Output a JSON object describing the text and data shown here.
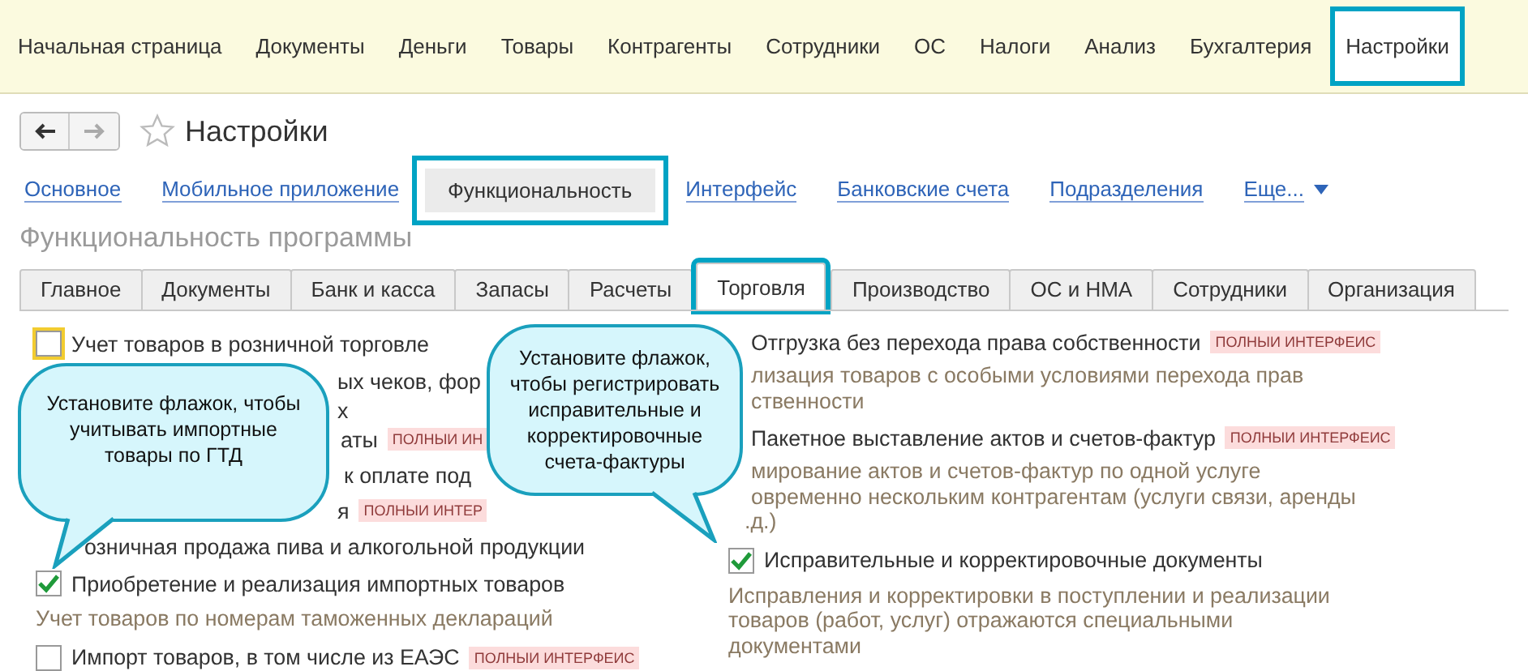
{
  "top_nav": [
    {
      "label": "Начальная страница",
      "selected": false,
      "highlighted": false
    },
    {
      "label": "Документы",
      "selected": false,
      "highlighted": false
    },
    {
      "label": "Деньги",
      "selected": false,
      "highlighted": false
    },
    {
      "label": "Товары",
      "selected": false,
      "highlighted": false
    },
    {
      "label": "Контрагенты",
      "selected": false,
      "highlighted": false
    },
    {
      "label": "Сотрудники",
      "selected": false,
      "highlighted": false
    },
    {
      "label": "ОС",
      "selected": false,
      "highlighted": false
    },
    {
      "label": "Налоги",
      "selected": false,
      "highlighted": false
    },
    {
      "label": "Анализ",
      "selected": false,
      "highlighted": false
    },
    {
      "label": "Бухгалтерия",
      "selected": false,
      "highlighted": false
    },
    {
      "label": "Настройки",
      "selected": true,
      "highlighted": true
    }
  ],
  "window": {
    "title": "Настройки",
    "favorite": false
  },
  "section_links": [
    {
      "label": "Основное",
      "selected": false,
      "highlighted": false
    },
    {
      "label": "Мобильное приложение",
      "selected": false,
      "highlighted": false
    },
    {
      "label": "Функциональность",
      "selected": true,
      "highlighted": true
    },
    {
      "label": "Интерфейс",
      "selected": false,
      "highlighted": false
    },
    {
      "label": "Банковские счета",
      "selected": false,
      "highlighted": false
    },
    {
      "label": "Подразделения",
      "selected": false,
      "highlighted": false
    },
    {
      "label": "Еще...",
      "selected": false,
      "highlighted": false,
      "dropdown": true
    }
  ],
  "heading": "Функциональность программы",
  "tabs": [
    {
      "label": "Главное",
      "selected": false,
      "highlighted": false
    },
    {
      "label": "Документы",
      "selected": false,
      "highlighted": false
    },
    {
      "label": "Банк и касса",
      "selected": false,
      "highlighted": false
    },
    {
      "label": "Запасы",
      "selected": false,
      "highlighted": false
    },
    {
      "label": "Расчеты",
      "selected": false,
      "highlighted": false
    },
    {
      "label": "Торговля",
      "selected": true,
      "highlighted": true
    },
    {
      "label": "Производство",
      "selected": false,
      "highlighted": false
    },
    {
      "label": "ОС и НМА",
      "selected": false,
      "highlighted": false
    },
    {
      "label": "Сотрудники",
      "selected": false,
      "highlighted": false
    },
    {
      "label": "Организация",
      "selected": false,
      "highlighted": false
    }
  ],
  "left_column": [
    {
      "kind": "option",
      "label": "Учет товаров в розничной торговле",
      "checked": false,
      "focused": true
    },
    {
      "kind": "fragment",
      "text": "ых чеков, фор"
    },
    {
      "kind": "fragment",
      "text": "х"
    },
    {
      "kind": "fragment",
      "text": "аты",
      "badge": "ПОЛНЫИ ИН"
    },
    {
      "kind": "fragment",
      "text": "к оплате под"
    },
    {
      "kind": "fragment",
      "text": "я",
      "badge": "ПОЛНЫИ ИНТЕР"
    },
    {
      "kind": "fragment",
      "text": "озничная продажа пива и алкогольной продукции"
    },
    {
      "kind": "option",
      "label": "Приобретение и реализация импортных товаров",
      "checked": true
    },
    {
      "kind": "desc",
      "lines": [
        "Учет товаров по номерам таможенных деклараций"
      ]
    },
    {
      "kind": "option",
      "label": "Импорт товаров, в том числе из ЕАЭС",
      "checked": false,
      "badge": "ПОЛНЫИ ИНТЕРФЕИС"
    }
  ],
  "right_column": [
    {
      "kind": "fragment",
      "text": "Отгрузка без перехода права собственности",
      "badge": "ПОЛНЫИ ИНТЕРФЕИС"
    },
    {
      "kind": "desc",
      "lines": [
        "лизация товаров с особыми условиями перехода прав",
        "ственности"
      ]
    },
    {
      "kind": "fragment",
      "text": "Пакетное выставление актов и счетов-фактур",
      "badge": "ПОЛНЫИ ИНТЕРФЕИС"
    },
    {
      "kind": "desc",
      "lines": [
        "мирование актов и счетов-фактур по одной услуге",
        "овременно нескольким контрагентам (услуги связи, аренды",
        ".д.)"
      ]
    },
    {
      "kind": "option",
      "label": "Исправительные и корректировочные документы",
      "checked": true
    },
    {
      "kind": "desc",
      "lines": [
        "Исправления и корректировки в поступлении и реализации",
        "товаров (работ, услуг) отражаются специальными",
        "документами"
      ]
    }
  ],
  "callouts": [
    "Установите флажок, чтобы учитывать импортные товары по ГТД",
    "Установите флажок, чтобы регистрировать исправительные и корректировочные счета-фактуры"
  ]
}
